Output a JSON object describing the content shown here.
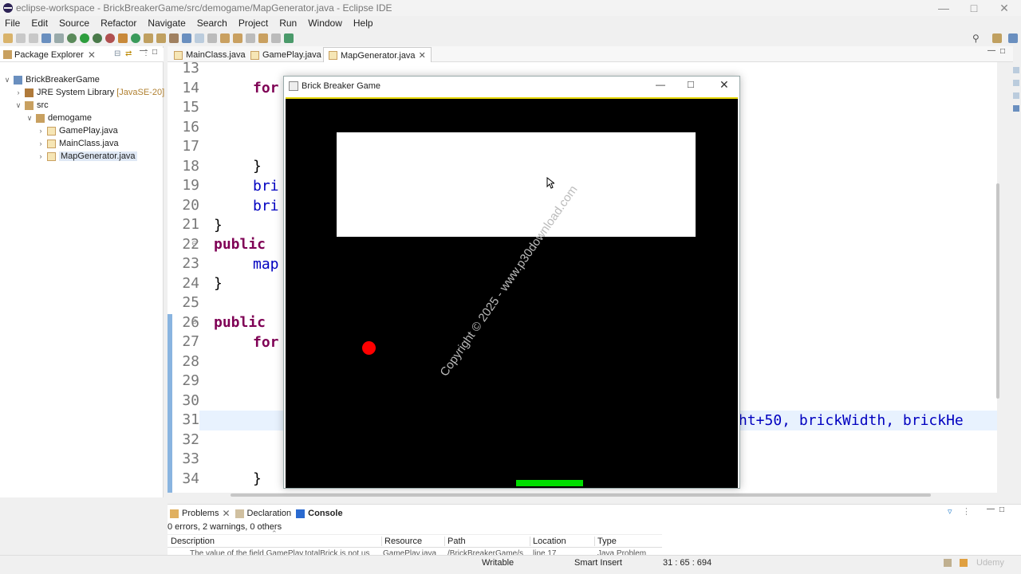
{
  "window": {
    "title": "eclipse-workspace - BrickBreakerGame/src/demogame/MapGenerator.java - Eclipse IDE"
  },
  "menu": [
    "File",
    "Edit",
    "Source",
    "Refactor",
    "Navigate",
    "Search",
    "Project",
    "Run",
    "Window",
    "Help"
  ],
  "package_explorer": {
    "tab_label": "Package Explorer",
    "tree": [
      {
        "label": "BrickBreakerGame",
        "extra": "",
        "level": 0,
        "twisty": "open"
      },
      {
        "label": "JRE System Library",
        "extra": "[JavaSE-20]",
        "level": 1,
        "twisty": "closed"
      },
      {
        "label": "src",
        "extra": "",
        "level": 1,
        "twisty": "open"
      },
      {
        "label": "demogame",
        "extra": "",
        "level": 2,
        "twisty": "open"
      },
      {
        "label": "GamePlay.java",
        "extra": "",
        "level": 3,
        "twisty": "closed"
      },
      {
        "label": "MainClass.java",
        "extra": "",
        "level": 3,
        "twisty": "closed"
      },
      {
        "label": "MapGenerator.java",
        "extra": "",
        "level": 3,
        "twisty": "closed",
        "selected": true
      }
    ]
  },
  "editor": {
    "tabs": [
      {
        "label": "MainClass.java",
        "active": false
      },
      {
        "label": "GamePlay.java",
        "active": false
      },
      {
        "label": "MapGenerator.java",
        "active": true
      }
    ],
    "line_numbers": [
      "13",
      "14",
      "15",
      "16",
      "17",
      "18",
      "19",
      "20",
      "21",
      "22",
      "23",
      "24",
      "25",
      "26",
      "27",
      "28",
      "29",
      "30",
      "31",
      "32",
      "33",
      "34"
    ],
    "fold_markers": {
      "22": "⊖",
      "26": "⊖"
    },
    "code_line_14": "for",
    "code_line_18": "}",
    "code_line_19": "bri",
    "code_line_20": "bri",
    "code_line_21": "}",
    "code_line_22_kw": "public",
    "code_line_22_rest": " ",
    "code_line_23": "map",
    "code_line_24": "}",
    "code_line_26_kw": "public",
    "code_line_27": "for",
    "code_line_31_tail": "ht+50, brickWidth, brickHe",
    "code_line_34": "}"
  },
  "game_window": {
    "title": "Brick Breaker Game",
    "watermark": "Copyright © 2025 - www.p30download.com",
    "colors": {
      "ball": "#ff0000",
      "paddle": "#00dd00",
      "bricks_area": "#ffffff",
      "border": "#e6d600"
    }
  },
  "bottom_panel": {
    "tabs": [
      {
        "label": "Problems",
        "active": false
      },
      {
        "label": "Declaration",
        "active": false
      },
      {
        "label": "Console",
        "active": true
      }
    ],
    "summary": "0 errors, 2 warnings, 0 others",
    "columns": [
      "Description",
      "Resource",
      "Path",
      "Location",
      "Type"
    ],
    "partial_row": {
      "description": "The value of the field GamePlay.totalBrick is not us",
      "resource": "GamePlay.java",
      "path": "/BrickBreakerGame/s",
      "location": "line 17",
      "type": "Java Problem"
    }
  },
  "statusbar": {
    "writable": "Writable",
    "insert_mode": "Smart Insert",
    "position": "31 : 65 : 694",
    "badge": "Udemy"
  }
}
